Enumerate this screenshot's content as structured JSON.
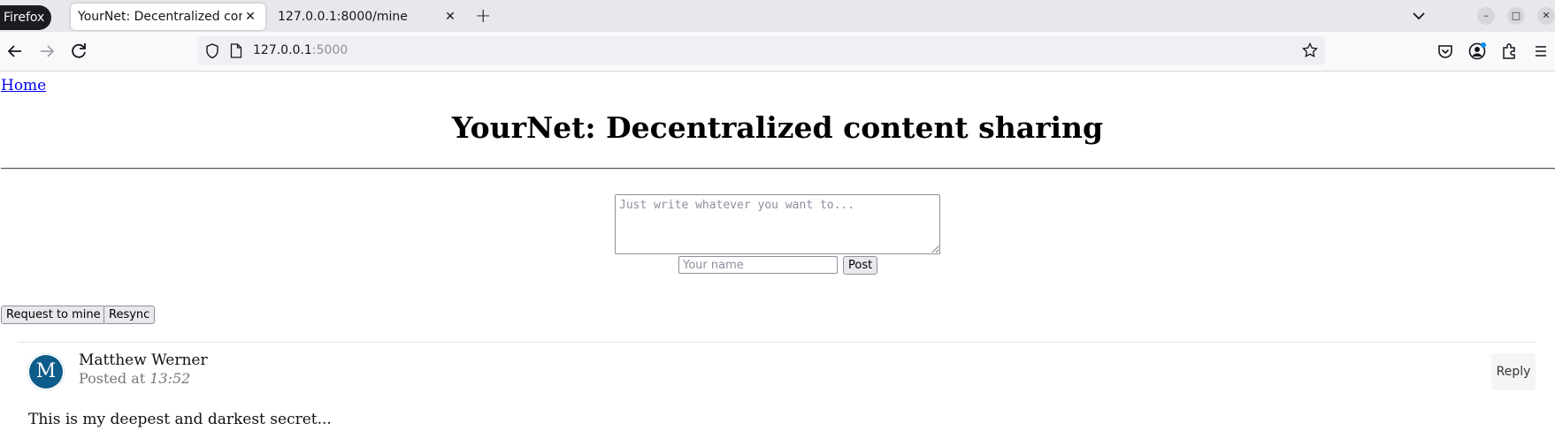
{
  "browser": {
    "badge": "Firefox",
    "tabs": [
      {
        "title": "YourNet: Decentralized cont",
        "active": true
      },
      {
        "title": "127.0.0.1:8000/mine",
        "active": false
      }
    ],
    "url": {
      "host": "127.0.0.1",
      "port": ":5000"
    }
  },
  "page": {
    "home_link": "Home",
    "title": "YourNet: Decentralized content sharing",
    "compose": {
      "textarea_placeholder": "Just write whatever you want to...",
      "name_placeholder": "Your name",
      "post_label": "Post"
    },
    "actions": {
      "request_label": "Request to mine",
      "resync_label": "Resync"
    },
    "posts": [
      {
        "avatar_letter": "M",
        "author": "Matthew Werner",
        "posted_prefix": "Posted at",
        "time": "13:52",
        "reply_label": "Reply",
        "body": "This is my deepest and darkest secret..."
      }
    ]
  },
  "colors": {
    "avatar": "#0d5c8a",
    "link": "#0000ee"
  }
}
